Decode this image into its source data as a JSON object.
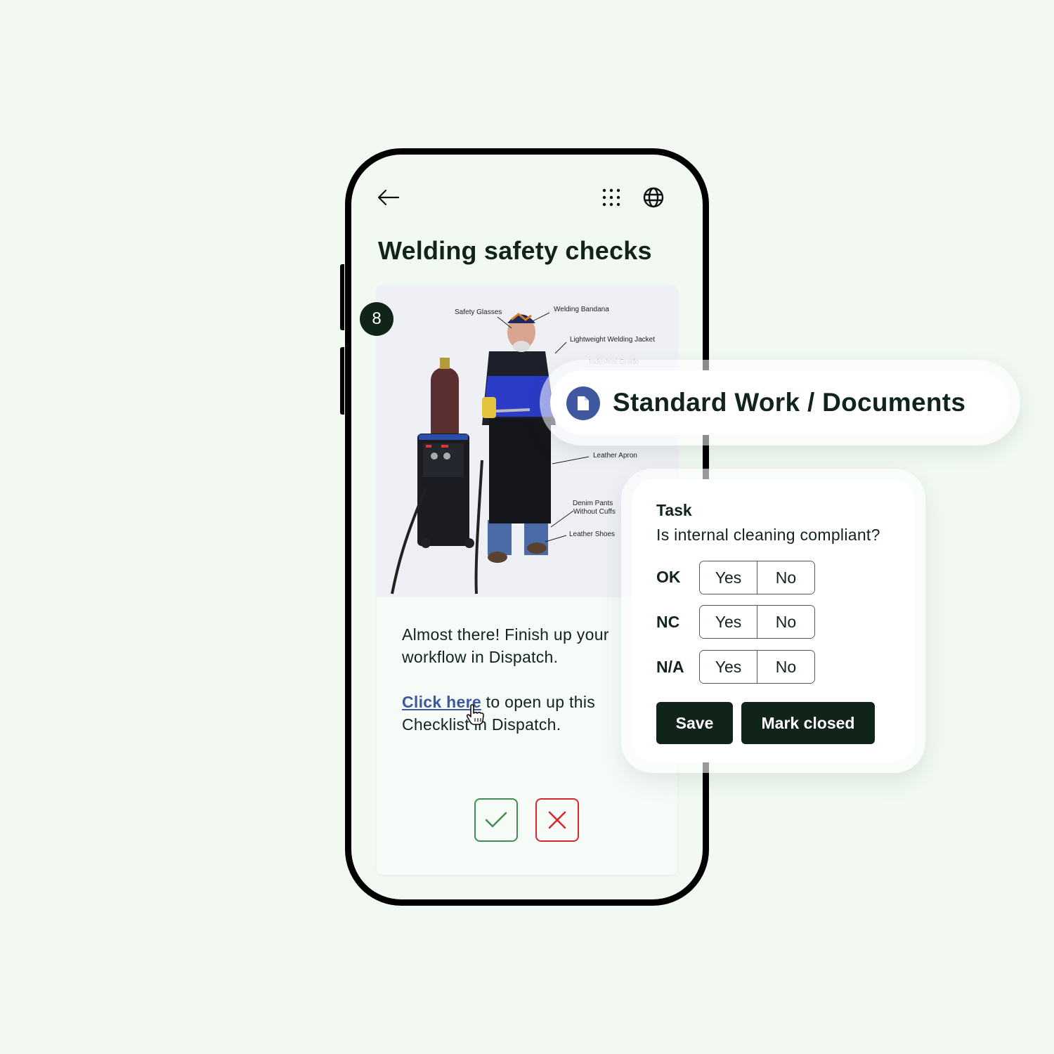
{
  "screen": {
    "title": "Welding safety checks",
    "step_number": "8",
    "header_icons": [
      "back-arrow-icon",
      "apps-grid-icon",
      "globe-icon"
    ],
    "image_labels": {
      "safety_glasses": "Safety Glasses",
      "welding_bandana": "Welding Bandana",
      "jacket": "Lightweight Welding Jacket",
      "industrial_grade": "Industrial Grade",
      "leather_apron": "Leather Apron",
      "denim_line1": "Denim Pants",
      "denim_line2": "Without Cuffs",
      "leather_shoes": "Leather Shoes"
    },
    "message": "Almost there! Finish up your workflow in Dispatch.",
    "link_text": "Click here",
    "link_suffix": " to open up this Checklist in Dispatch.",
    "approve_icon": "check-icon",
    "reject_icon": "x-icon"
  },
  "pill": {
    "icon": "document-icon",
    "label": "Standard Work / Documents"
  },
  "task_card": {
    "heading": "Task",
    "question": "Is internal cleaning compliant?",
    "rows": [
      {
        "label": "OK",
        "yes": "Yes",
        "no": "No"
      },
      {
        "label": "NC",
        "yes": "Yes",
        "no": "No"
      },
      {
        "label": "N/A",
        "yes": "Yes",
        "no": "No"
      }
    ],
    "save_label": "Save",
    "close_label": "Mark closed"
  },
  "colors": {
    "background": "#f1f9f2",
    "primary_dark": "#11241a",
    "link_blue": "#3e58a0",
    "doc_icon_blue": "#4058a0",
    "approve_green": "#3f8f52",
    "reject_red": "#d6272f"
  }
}
